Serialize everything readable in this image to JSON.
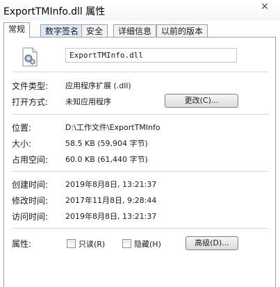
{
  "window": {
    "title": "ExportTMInfo.dll 属性",
    "close_glyph": "✕"
  },
  "tabs": [
    "常规",
    "数字签名",
    "安全",
    "详细信息",
    "以前的版本"
  ],
  "general": {
    "file_name": "ExportTMInfo.dll",
    "file_type": {
      "label": "文件类型:",
      "value": "应用程序扩展 (.dll)"
    },
    "opens_with": {
      "label": "打开方式:",
      "value": "未知应用程序",
      "change_button": "更改(C)..."
    },
    "location": {
      "label": "位置:",
      "value": "D:\\工作文件\\ExportTMInfo"
    },
    "size": {
      "label": "大小:",
      "value": "58.5 KB (59,904 字节)"
    },
    "size_on_disk": {
      "label": "占用空间:",
      "value": "60.0 KB (61,440 字节)"
    },
    "created": {
      "label": "创建时间:",
      "value": "2019年8月8日, 13:21:37"
    },
    "modified": {
      "label": "修改时间:",
      "value": "2017年11月8日, 9:28:44"
    },
    "accessed": {
      "label": "访问时间:",
      "value": "2019年8月8日, 13:21:37"
    },
    "attributes": {
      "label": "属性:",
      "readonly": "只读(R)",
      "hidden": "隐藏(H)",
      "advanced_button": "高级(D)..."
    }
  },
  "icons": {
    "file_icon": "dll-gear-file-icon",
    "close": "close-icon"
  }
}
